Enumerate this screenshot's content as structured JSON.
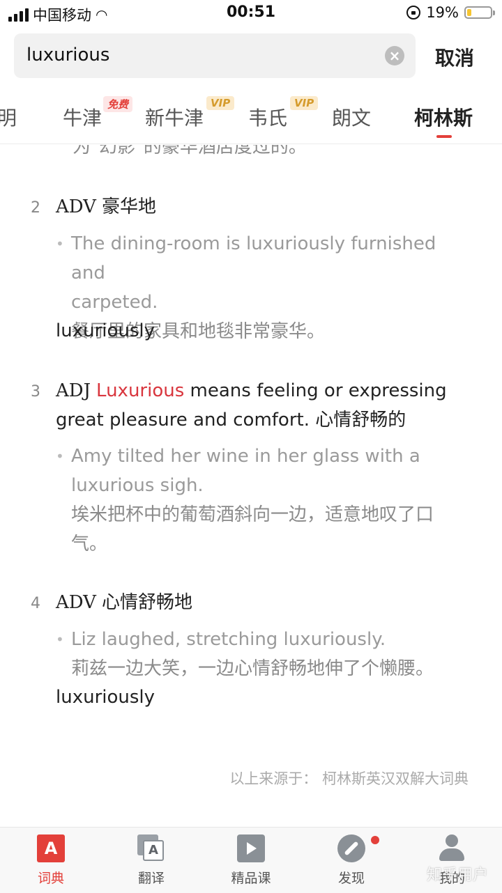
{
  "status_bar": {
    "carrier": "中国移动",
    "time": "00:51",
    "battery": "19%",
    "battery_level": 0.19
  },
  "search": {
    "query": "luxurious",
    "cancel_label": "取消"
  },
  "tabs": [
    {
      "label": "明"
    },
    {
      "label": "牛津",
      "badge": "免费"
    },
    {
      "label": "新牛津",
      "badge": "VIP"
    },
    {
      "label": "韦氏",
      "badge": "VIP"
    },
    {
      "label": "朗文"
    },
    {
      "label": "柯林斯",
      "active": true
    }
  ],
  "content": {
    "partial_line": "为\"幻影\"的豪华酒店度过的。",
    "definitions": [
      {
        "num": "2",
        "pos": "ADV",
        "meaning": "豪华地",
        "example_en_1": "The dining-room is luxuriously furnished and",
        "example_en_2": "carpeted.",
        "example_cn": "餐厅里的家具和地毯非常豪华。",
        "word": "luxuriously"
      },
      {
        "num": "3",
        "pos": "ADJ",
        "keyword": "Luxurious",
        "meaning_1": " means feeling or expressing",
        "meaning_2": "great pleasure and comfort. 心情舒畅的",
        "example_en_1": "Amy tilted her wine in her glass with a",
        "example_en_2": "luxurious sigh.",
        "example_cn_1": "埃米把杯中的葡萄酒斜向一边，适意地叹了口",
        "example_cn_2": "气。"
      },
      {
        "num": "4",
        "pos": "ADV",
        "meaning": "心情舒畅地",
        "example_en_1": "Liz laughed, stretching luxuriously.",
        "example_cn": "莉兹一边大笑，一边心情舒畅地伸了个懒腰。",
        "word": "luxuriously"
      }
    ],
    "source": "以上来源于：  柯林斯英汉双解大词典"
  },
  "bottom_nav": [
    {
      "label": "词典",
      "icon": "dictionary-icon",
      "active": true
    },
    {
      "label": "翻译",
      "icon": "translate-icon"
    },
    {
      "label": "精品课",
      "icon": "course-icon"
    },
    {
      "label": "发现",
      "icon": "compass-icon"
    },
    {
      "label": "我的",
      "icon": "profile-icon"
    }
  ],
  "watermark": "知乎用户",
  "colors": {
    "accent": "#e3403a",
    "keyword": "#d9363e"
  }
}
